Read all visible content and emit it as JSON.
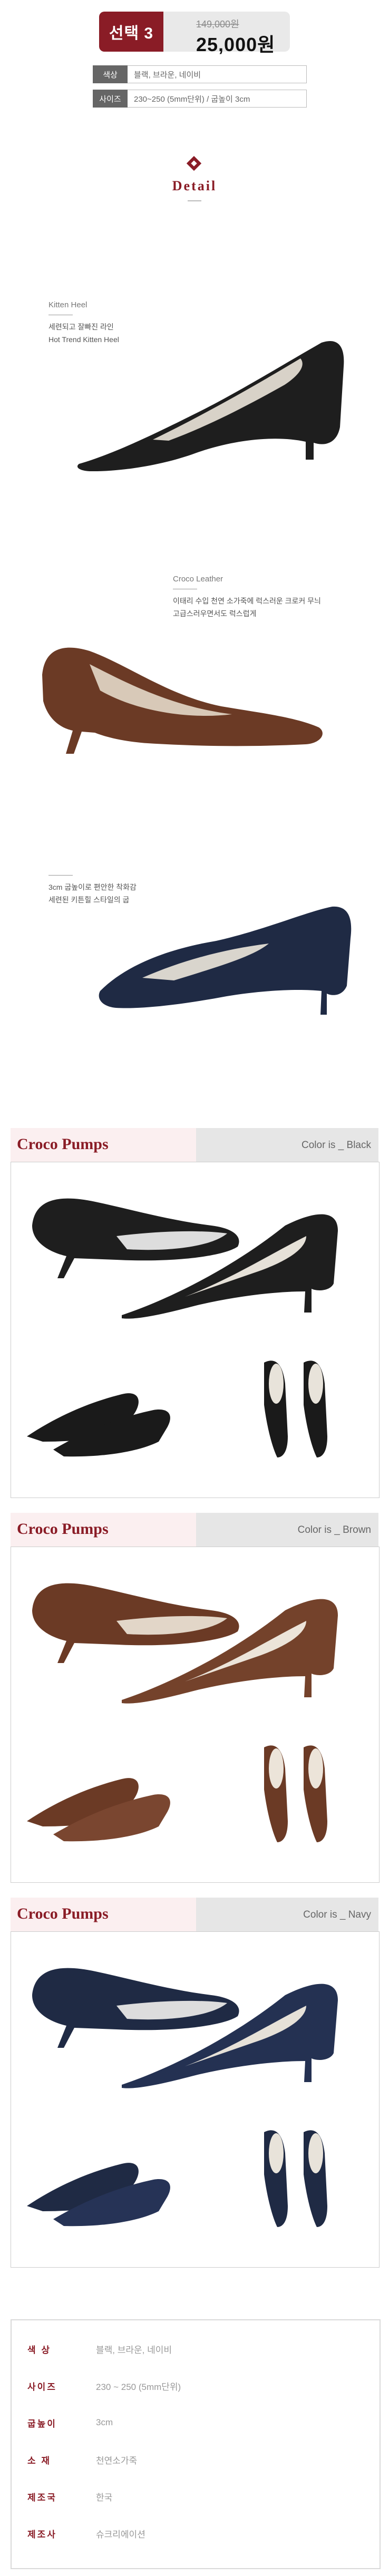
{
  "header": {
    "select_label": "선택 3",
    "old_price": "149,000원",
    "new_price": "25,000원"
  },
  "options": [
    {
      "label": "색상",
      "value": "블랙, 브라운, 네이비"
    },
    {
      "label": "사이즈",
      "value": "230~250 (5mm단위) / 굽높이 3cm"
    }
  ],
  "detail": {
    "title": "Detail"
  },
  "features": [
    {
      "title": "Kitten Heel",
      "lines": [
        "세련되고 잘빠진 라인",
        "Hot Trend Kitten Heel"
      ]
    },
    {
      "title": "Croco Leather",
      "lines": [
        "이태리 수입 천연 소가죽에 럭스러운 크로커 무늬",
        "고급스러우면서도 럭스럽게"
      ]
    },
    {
      "title": "",
      "lines": [
        "3cm 굽높이로 편안한 착화감",
        "세련된 키튼힐 스타일의 굽"
      ]
    }
  ],
  "sections": [
    {
      "title": "Croco Pumps",
      "color_label": "Color is _ Black"
    },
    {
      "title": "Croco Pumps",
      "color_label": "Color is _ Brown"
    },
    {
      "title": "Croco Pumps",
      "color_label": "Color is _ Navy"
    }
  ],
  "colors": {
    "accent": "#8a1c26",
    "black_shoe": "#1e1e1e",
    "brown_shoe": "#6b3a25",
    "navy_shoe": "#1f2a44"
  },
  "specs": [
    {
      "key": "색 상",
      "value": "블랙, 브라운, 네이비"
    },
    {
      "key": "사이즈",
      "value": "230 ~ 250 (5mm단위)"
    },
    {
      "key": "굽높이",
      "value": "3cm"
    },
    {
      "key": "소 재",
      "value": "천연소가죽"
    },
    {
      "key": "제조국",
      "value": "한국"
    },
    {
      "key": "제조사",
      "value": "슈크리에이션"
    }
  ]
}
